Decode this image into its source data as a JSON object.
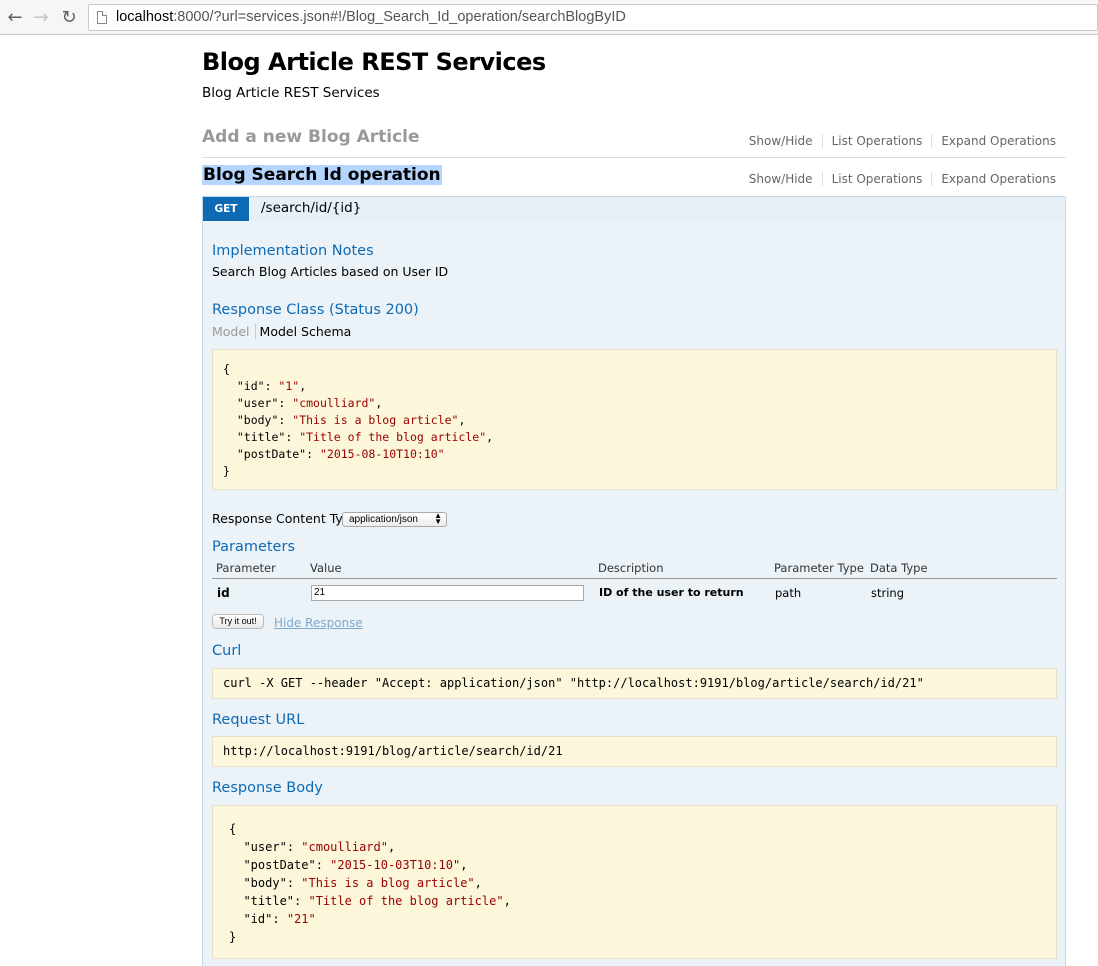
{
  "browser": {
    "url_host": "localhost",
    "url_rest": ":8000/?url=services.json#!/Blog_Search_Id_operation/searchBlogByID"
  },
  "page": {
    "title": "Blog Article REST Services",
    "subtitle": "Blog Article REST Services"
  },
  "sections": [
    {
      "name": "Add a new Blog Article",
      "ops": [
        "Show/Hide",
        "List Operations",
        "Expand Operations"
      ]
    },
    {
      "name": "Blog Search Id operation",
      "ops": [
        "Show/Hide",
        "List Operations",
        "Expand Operations"
      ]
    }
  ],
  "operation": {
    "method": "GET",
    "path": "/search/id/{id}",
    "impl_notes_title": "Implementation Notes",
    "impl_notes": "Search Blog Articles based on User ID",
    "response_class_title": "Response Class (Status 200)",
    "model_tab": "Model",
    "schema_tab": "Model Schema",
    "schema": {
      "open": "{",
      "lines": [
        {
          "key": "\"id\"",
          "val": "\"1\"",
          "sep": ","
        },
        {
          "key": "\"user\"",
          "val": "\"cmoulliard\"",
          "sep": ","
        },
        {
          "key": "\"body\"",
          "val": "\"This is a blog article\"",
          "sep": ","
        },
        {
          "key": "\"title\"",
          "val": "\"Title of the blog article\"",
          "sep": ","
        },
        {
          "key": "\"postDate\"",
          "val": "\"2015-08-10T10:10\"",
          "sep": ""
        }
      ],
      "close": "}"
    },
    "content_type_label": "Response Content Type",
    "content_type_value": "application/json",
    "parameters_title": "Parameters",
    "param_headers": [
      "Parameter",
      "Value",
      "Description",
      "Parameter Type",
      "Data Type"
    ],
    "param": {
      "name": "id",
      "value": "21",
      "description": "ID of the user to return",
      "type": "path",
      "data_type": "string"
    },
    "try_button": "Try it out!",
    "hide_response": "Hide Response",
    "curl_title": "Curl",
    "curl": "curl -X GET --header \"Accept: application/json\" \"http://localhost:9191/blog/article/search/id/21\"",
    "request_url_title": "Request URL",
    "request_url": "http://localhost:9191/blog/article/search/id/21",
    "response_body_title": "Response Body",
    "response_body": {
      "open": "{",
      "lines": [
        {
          "key": "\"user\"",
          "val": "\"cmoulliard\"",
          "sep": ","
        },
        {
          "key": "\"postDate\"",
          "val": "\"2015-10-03T10:10\"",
          "sep": ","
        },
        {
          "key": "\"body\"",
          "val": "\"This is a blog article\"",
          "sep": ","
        },
        {
          "key": "\"title\"",
          "val": "\"Title of the blog article\"",
          "sep": ","
        },
        {
          "key": "\"id\"",
          "val": "\"21\"",
          "sep": ""
        }
      ],
      "close": "}"
    }
  },
  "colors": {
    "accent": "#0f6ab4",
    "code_bg": "#fcf6db",
    "string": "#990000",
    "op_bg": "#ebf3f9"
  }
}
